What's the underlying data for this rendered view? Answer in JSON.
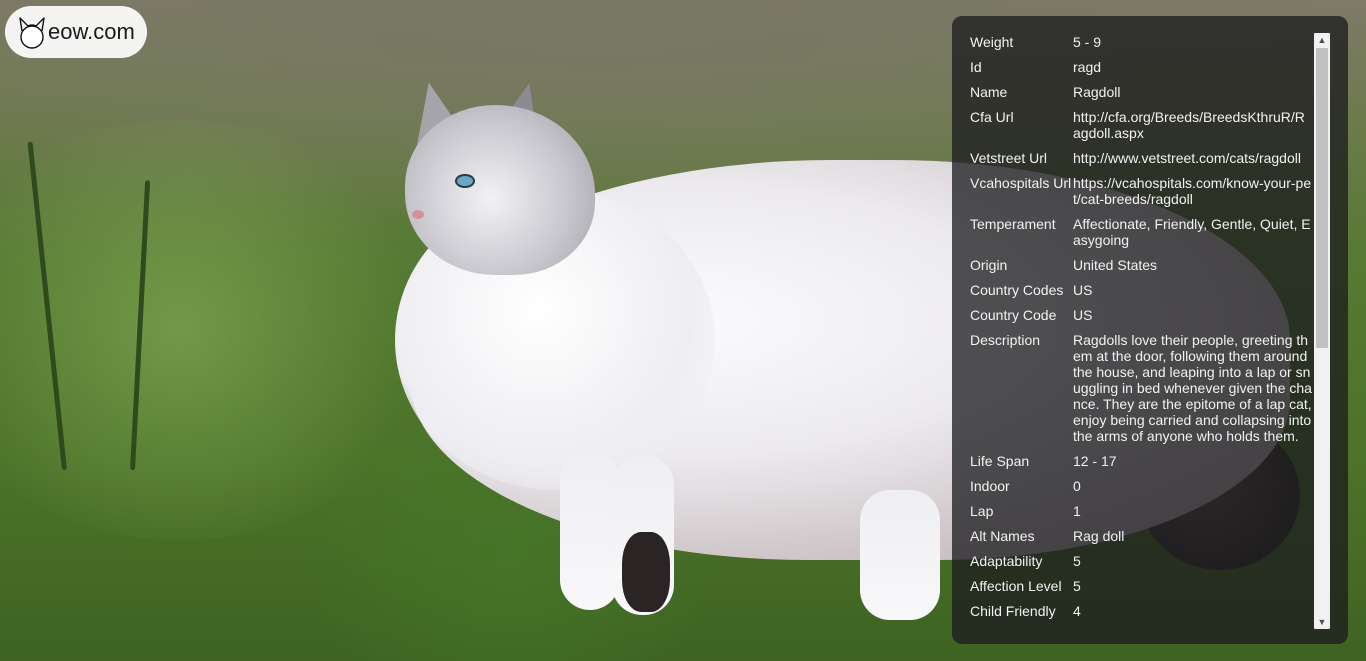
{
  "logo": {
    "text": "eow.com",
    "icon": "cat-head-icon"
  },
  "breed_info": [
    {
      "key": "Weight",
      "value": "5 - 9"
    },
    {
      "key": "Id",
      "value": "ragd"
    },
    {
      "key": "Name",
      "value": "Ragdoll"
    },
    {
      "key": "Cfa Url",
      "value": "http://cfa.org/Breeds/BreedsKthruR/Ragdoll.aspx"
    },
    {
      "key": "Vetstreet Url",
      "value": "http://www.vetstreet.com/cats/ragdoll"
    },
    {
      "key": "Vcahospitals Url",
      "value": "https://vcahospitals.com/know-your-pet/cat-breeds/ragdoll"
    },
    {
      "key": "Temperament",
      "value": "Affectionate, Friendly, Gentle, Quiet, Easygoing"
    },
    {
      "key": "Origin",
      "value": "United States"
    },
    {
      "key": "Country Codes",
      "value": "US"
    },
    {
      "key": "Country Code",
      "value": "US"
    },
    {
      "key": "Description",
      "value": "Ragdolls love their people, greeting them at the door, following them around the house, and leaping into a lap or snuggling in bed whenever given the chance. They are the epitome of a lap cat, enjoy being carried and collapsing into the arms of anyone who holds them."
    },
    {
      "key": "Life Span",
      "value": "12 - 17"
    },
    {
      "key": "Indoor",
      "value": "0"
    },
    {
      "key": "Lap",
      "value": "1"
    },
    {
      "key": "Alt Names",
      "value": "Rag doll"
    },
    {
      "key": "Adaptability",
      "value": "5"
    },
    {
      "key": "Affection Level",
      "value": "5"
    },
    {
      "key": "Child Friendly",
      "value": "4"
    }
  ],
  "colors": {
    "panel_bg": "rgba(28,28,30,0.76)",
    "panel_text": "#f2f2f2",
    "logo_bg": "#ffffff"
  },
  "icons": {
    "scroll_up": "triangle-up-icon",
    "scroll_down": "triangle-down-icon"
  },
  "scrollbar": {
    "up_glyph": "▲",
    "down_glyph": "▼"
  }
}
